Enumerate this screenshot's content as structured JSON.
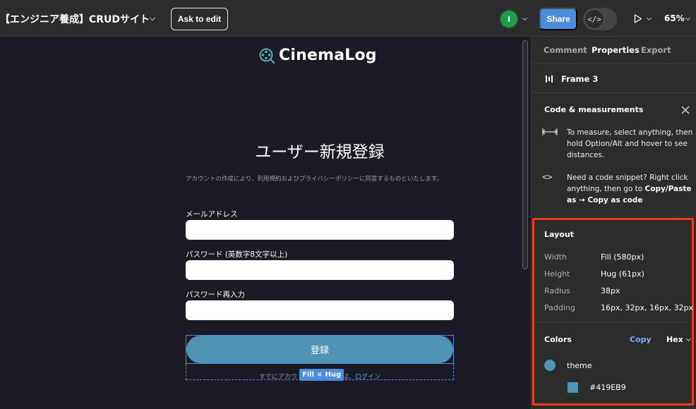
{
  "topbar": {
    "file_title": "【エンジニア養成】CRUDサイト",
    "ask_to_edit": "Ask to edit",
    "avatar_initial": "I",
    "share": "Share",
    "devmode_symbol": "</>",
    "zoom": "65%"
  },
  "canvas": {
    "logo_text": "CinemaLog",
    "form_title": "ユーザー新規登録",
    "form_description": "アカウントの作成により、利用規約およびプライバシーポリシーに同意するものといたします。",
    "fields": [
      {
        "label": "メールアドレス",
        "value": ""
      },
      {
        "label": "パスワード (英数字8文字以上)",
        "value": ""
      },
      {
        "label": "パスワード再入力",
        "value": ""
      }
    ],
    "submit_label": "登録",
    "login_prefix": "すでにアカウ",
    "login_middle": "方は、",
    "login_link": "ログイン",
    "selection_tag": "Fill × Hug"
  },
  "panel": {
    "tabs": [
      "Comment",
      "Properties",
      "Export"
    ],
    "active_tab": "Properties",
    "frame_name": "Frame 3",
    "code_title": "Code & measurements",
    "hint_measure": "To measure, select anything, then hold Option/Alt and hover to see distances.",
    "hint_code_1": "Need a code snippet? Right click anything, then go to ",
    "hint_code_bold": "Copy/Paste as → Copy as code",
    "layout": {
      "title": "Layout",
      "props": [
        {
          "key": "Width",
          "value": "Fill (580px)"
        },
        {
          "key": "Height",
          "value": "Hug (61px)"
        },
        {
          "key": "Radius",
          "value": "38px"
        },
        {
          "key": "Padding",
          "value": "16px, 32px, 16px, 32px"
        }
      ]
    },
    "colors": {
      "title": "Colors",
      "copy": "Copy",
      "format": "Hex",
      "theme_name": "theme",
      "theme_hex": "#419EB9"
    }
  },
  "colors": {
    "accent": "#4a8de0",
    "theme": "#419EB9",
    "highlight": "#e8401c",
    "canvas_bg": "#1c1b25"
  }
}
